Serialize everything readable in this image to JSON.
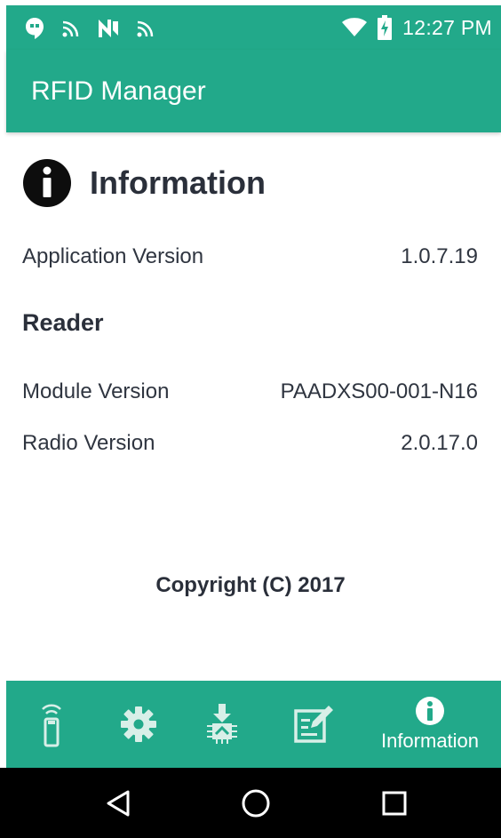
{
  "status_bar": {
    "time": "12:27 PM",
    "icons_left": [
      "hangouts-icon",
      "cast-icon",
      "nfc-icon",
      "cast-icon"
    ],
    "icons_right": [
      "wifi-icon",
      "battery-charging-icon"
    ]
  },
  "app_bar": {
    "title": "RFID Manager"
  },
  "info": {
    "heading": "Information",
    "app_version_label": "Application Version",
    "app_version_value": "1.0.7.19",
    "reader_section": "Reader",
    "module_version_label": "Module Version",
    "module_version_value": "PAADXS00-001-N16",
    "radio_version_label": "Radio Version",
    "radio_version_value": "2.0.17.0",
    "copyright": "Copyright (C) 2017"
  },
  "bottom_nav": {
    "items": [
      {
        "icon": "rfid-reader-icon",
        "label": ""
      },
      {
        "icon": "gear-icon",
        "label": ""
      },
      {
        "icon": "download-chip-icon",
        "label": ""
      },
      {
        "icon": "edit-document-icon",
        "label": ""
      },
      {
        "icon": "info-icon",
        "label": "Information",
        "active": true
      }
    ]
  },
  "system_nav": {
    "buttons": [
      "back-icon",
      "home-icon",
      "recents-icon"
    ]
  },
  "colors": {
    "primary": "#22a98a",
    "text": "#2a2f3a",
    "system_nav": "#000000"
  }
}
